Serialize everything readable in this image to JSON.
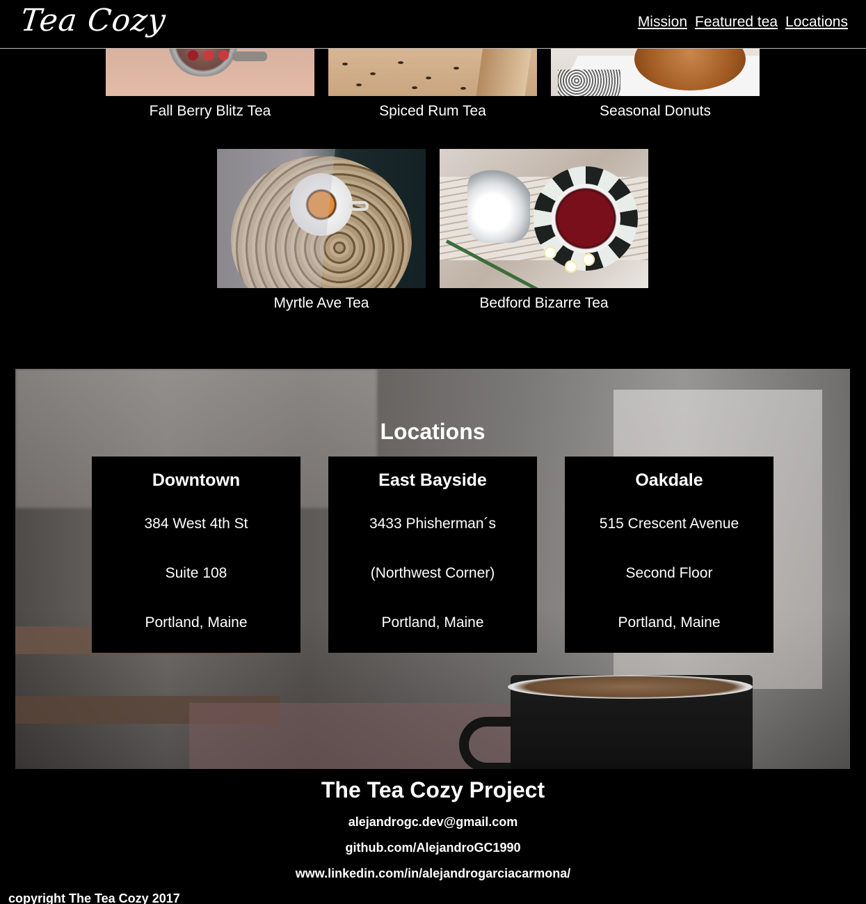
{
  "header": {
    "logo": "Tea Cozy",
    "nav": [
      "Mission",
      "Featured tea",
      "Locations"
    ]
  },
  "featured": {
    "items": [
      {
        "name": "Fall Berry Blitz Tea"
      },
      {
        "name": "Spiced Rum Tea"
      },
      {
        "name": "Seasonal Donuts"
      },
      {
        "name": "Myrtle Ave Tea"
      },
      {
        "name": "Bedford Bizarre Tea"
      }
    ]
  },
  "locations": {
    "title": "Locations",
    "cards": [
      {
        "name": "Downtown",
        "line1": "384 West 4th St",
        "line2": "Suite 108",
        "line3": "Portland, Maine"
      },
      {
        "name": "East Bayside",
        "line1": "3433 Phisherman´s",
        "line2": "(Northwest Corner)",
        "line3": "Portland, Maine"
      },
      {
        "name": "Oakdale",
        "line1": "515 Crescent Avenue",
        "line2": "Second Floor",
        "line3": "Portland, Maine"
      }
    ]
  },
  "footer": {
    "title": "The Tea Cozy Project",
    "email": "alejandrogc.dev@gmail.com",
    "github": "github.com/AlejandroGC1990",
    "linkedin": "www.linkedin.com/in/alejandrogarciacarmona/",
    "copyright": "copyright The Tea Cozy 2017"
  }
}
